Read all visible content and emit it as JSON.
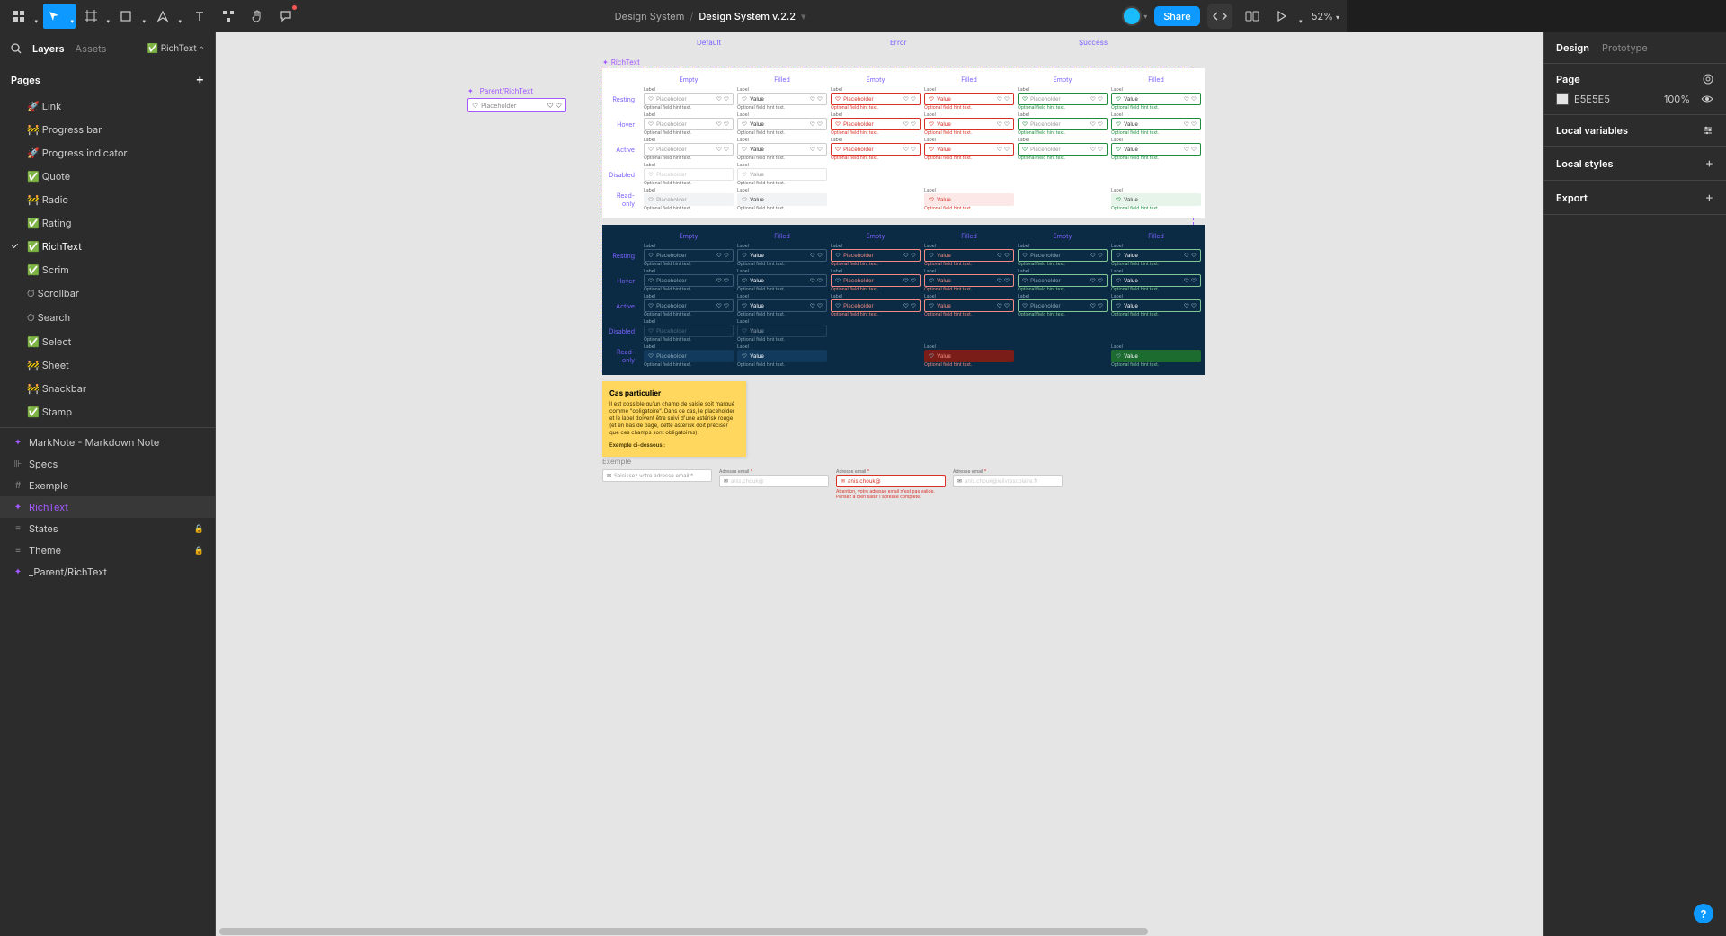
{
  "toolbar": {
    "zoom": "52%",
    "share": "Share"
  },
  "breadcrumb": {
    "project": "Design System",
    "file": "Design System v.2.2"
  },
  "leftPanel": {
    "tabs": {
      "layers": "Layers",
      "assets": "Assets"
    },
    "crumb": "✅ RichText",
    "pagesLabel": "Pages",
    "pages": [
      "🚀 Link",
      "🚧 Progress bar",
      "🚀 Progress indicator",
      "✅ Quote",
      "🚧 Radio",
      "✅ Rating",
      "✅ RichText",
      "✅ Scrim",
      "⏱ Scrollbar",
      "⏱ Search",
      "✅ Select",
      "🚧 Sheet",
      "🚧 Snackbar",
      "✅ Stamp"
    ],
    "selectedPage": "✅ RichText",
    "layers": [
      {
        "icon": "✦",
        "name": "MarkNote - Markdown Note",
        "comp": true
      },
      {
        "icon": "⊪",
        "name": "Specs"
      },
      {
        "icon": "#",
        "name": "Exemple"
      },
      {
        "icon": "✦",
        "name": "RichText",
        "sel": true,
        "comp": true
      },
      {
        "icon": "≡",
        "name": "States",
        "lock": true
      },
      {
        "icon": "≡",
        "name": "Theme",
        "lock": true
      },
      {
        "icon": "✦",
        "name": "_Parent/RichText",
        "comp": true
      }
    ]
  },
  "rightPanel": {
    "tabs": {
      "design": "Design",
      "prototype": "Prototype"
    },
    "pageLabel": "Page",
    "bgColor": "E5E5E5",
    "bgOpacity": "100%",
    "localVariables": "Local variables",
    "localStyles": "Local styles",
    "export": "Export"
  },
  "canvas": {
    "parentTitle": "_Parent/RichText",
    "statesTitle": "RichText",
    "placeholder": "Placeholder",
    "value": "Value",
    "label": "Label",
    "hint": "Optional field hint text.",
    "topCols": [
      "Default",
      "Error",
      "Success"
    ],
    "subCols": [
      "Empty",
      "Filled",
      "Empty",
      "Filled",
      "Empty",
      "Filled"
    ],
    "rows": [
      "Resting",
      "Hover",
      "Active",
      "Disabled",
      "Read-only"
    ]
  },
  "note": {
    "title": "Cas particulier",
    "body": "Il est possible qu'un champ de saisie soit marqué comme \"obligatoire\". Dans ce cas, le placeholder et le label doivent être suivi d'une astérisk rouge (et en bas de page, cette astérisk doit préciser que ces champs sont obligatoires).",
    "ex": "Exemple ci-dessous :"
  },
  "example": {
    "section": "Exemple",
    "label": "Adresse email",
    "placeholder": "Saisissez votre adresse email *",
    "v1": "anis.chouk@",
    "v2": "anis.chouk@",
    "v3": "anis.chouk@lelivrescolaire.fr",
    "err": "Attention, votre adresse email n'est pas valide. Pensez à bien saisir l'adresse complète."
  }
}
